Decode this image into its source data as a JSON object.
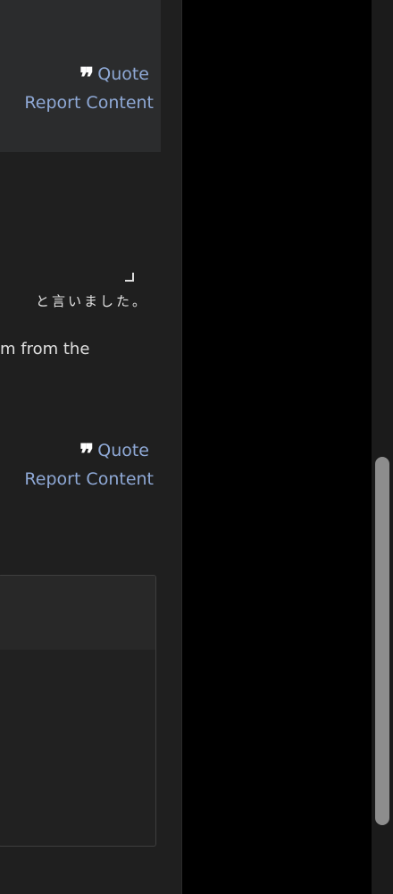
{
  "post1": {
    "quote_icon": "quote-icon",
    "quote_label": "Quote",
    "report_label": "Report Content"
  },
  "post2": {
    "japanese_text": "と言いました。",
    "body_text": "m from the",
    "quote_icon": "quote-icon",
    "quote_label": "Quote",
    "report_label": "Report Content"
  },
  "colors": {
    "link": "#8fa9d6",
    "content_background": "#1f1f1f",
    "post_background": "#2b2c2d",
    "page_background": "#000000",
    "scrollbar_thumb": "#8d8d8d"
  }
}
